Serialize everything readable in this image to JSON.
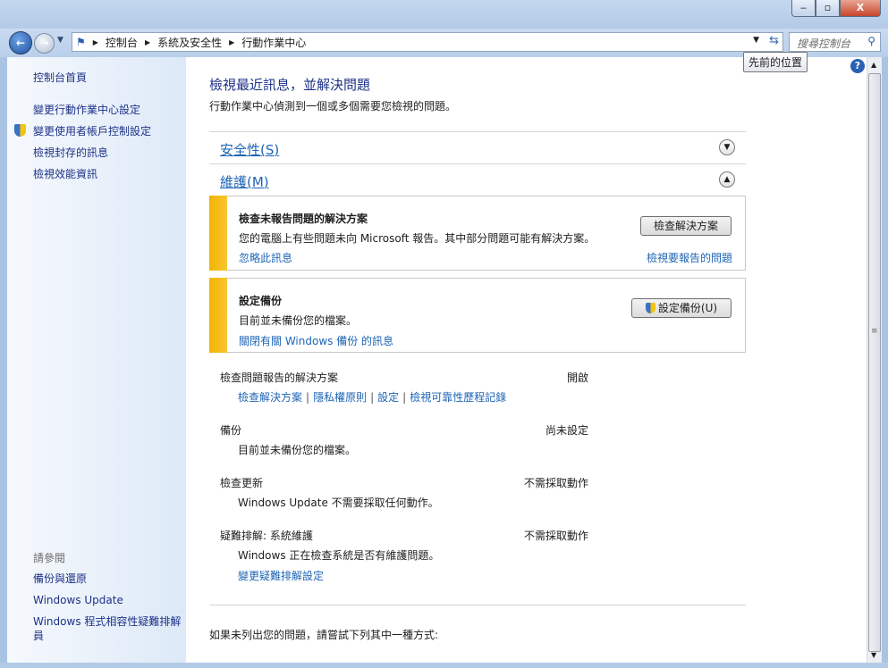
{
  "window": {
    "minimize": "‒",
    "maximize": "▫",
    "close": "X"
  },
  "nav": {
    "breadcrumbs": [
      "控制台",
      "系統及安全性",
      "行動作業中心"
    ],
    "search_placeholder": "搜尋控制台",
    "tooltip": "先前的位置"
  },
  "sidebar": {
    "links": [
      "控制台首頁",
      "變更行動作業中心設定",
      "變更使用者帳戶控制設定",
      "檢視封存的訊息",
      "檢視效能資訊"
    ],
    "see_also_title": "請參閱",
    "see_also": [
      "備份與還原",
      "Windows Update",
      "Windows 程式相容性疑難排解員"
    ]
  },
  "main": {
    "title": "檢視最近訊息，並解決問題",
    "intro": "行動作業中心偵測到一個或多個需要您檢視的問題。",
    "sections": [
      {
        "label": "安全性(S)",
        "state": "collapsed"
      },
      {
        "label": "維護(M)",
        "state": "expanded"
      }
    ],
    "cards": [
      {
        "heading": "檢查未報告問題的解決方案",
        "desc": "您的電腦上有些問題未向 Microsoft 報告。其中部分問題可能有解決方案。",
        "link_left": "忽略此訊息",
        "link_right": "檢視要報告的問題",
        "button": "檢查解決方案"
      },
      {
        "heading": "設定備份",
        "desc": "目前並未備份您的檔案。",
        "link_left": "關閉有關 Windows 備份 的訊息",
        "button": "設定備份(U)"
      }
    ],
    "rows": [
      {
        "key": "檢查問題報告的解決方案",
        "value": "開啟",
        "links": [
          "檢查解決方案",
          "隱私權原則",
          "設定",
          "檢視可靠性歷程記錄"
        ]
      },
      {
        "key": "備份",
        "value": "尚未設定",
        "sub": "目前並未備份您的檔案。"
      },
      {
        "key": "檢查更新",
        "value": "不需採取動作",
        "sub": "Windows Update 不需要採取任何動作。"
      },
      {
        "key": "疑難排解: 系統維護",
        "value": "不需採取動作",
        "sub": "Windows 正在檢查系統是否有維護問題。",
        "link": "變更疑難排解設定"
      }
    ],
    "footer": "如果未列出您的問題，請嘗試下列其中一種方式:"
  }
}
